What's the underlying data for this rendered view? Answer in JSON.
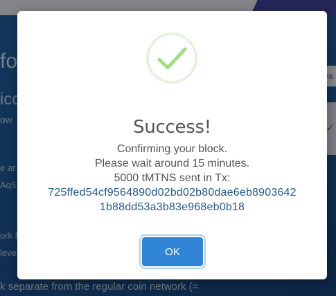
{
  "background": {
    "title_fragment": "fo",
    "subtitle_fragment": "ico",
    "line1_fragment": "ow",
    "line2_fragment": "e ar",
    "line3_fragment": "Aq5",
    "line4_fragment": "ork f",
    "line5_fragment": "leve",
    "bottom_text": "k separate from the regular coin network (=",
    "input_fragment": "va"
  },
  "modal": {
    "icon": "checkmark-success-icon",
    "title": "Success!",
    "line1": "Confirming your block.",
    "line2": "Please wait around 15 minutes.",
    "line3": "5000 tMTNS sent in Tx:",
    "tx_hash_line1": "725ffed54cf9564890d02bd02b80dae6eb8903642",
    "tx_hash_line2": "1b88dd53a3b83e968eb0b18",
    "ok_label": "OK"
  },
  "colors": {
    "success_green": "#a5dc86",
    "success_ring": "#e4f3dc",
    "button_blue": "#3085d6",
    "link_blue": "#24598f"
  }
}
